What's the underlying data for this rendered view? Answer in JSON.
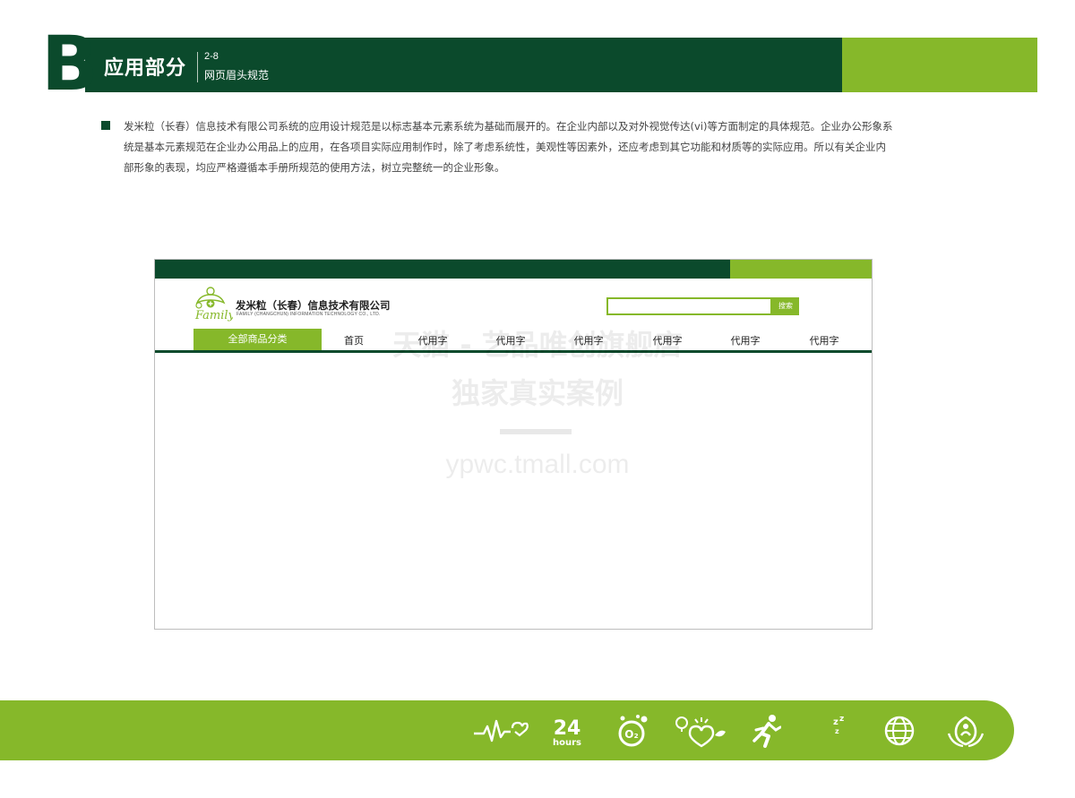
{
  "header": {
    "letter": "B",
    "section_title": "应用部分",
    "section_number": "2-8",
    "section_subtitle": "网页眉头规范"
  },
  "intro": {
    "text": "发米粒（长春）信息技术有限公司系统的应用设计规范是以标志基本元素系统为基础而展开的。在企业内部以及对外视觉传达(vi)等方面制定的具体规范。企业办公形象系统是基本元素规范在企业办公用品上的应用，在各项目实际应用制作时，除了考虑系统性，美观性等因素外，还应考虑到其它功能和材质等的实际应用。所以有关企业内部形象的表现，均应严格遵循本手册所规范的使用方法，树立完整统一的企业形象。"
  },
  "mockup": {
    "logo_text": "Family",
    "company_cn": "发米粒（长春）信息技术有限公司",
    "company_en": "FAMILY (CHANGCHUN) INFORMATION TECHNOLOGY CO., LTD.",
    "search_value": "",
    "search_button": "搜索",
    "nav": {
      "category": "全部商品分类",
      "items": [
        "首页",
        "代用字",
        "代用字",
        "代用字",
        "代用字",
        "代用字",
        "代用字"
      ]
    }
  },
  "watermark": {
    "line1": "天猫 - 艺品唯创旗舰店",
    "line2": "独家真实案例",
    "line3": "ypwc.tmall.com"
  },
  "footer": {
    "icons": [
      "heartbeat-icon",
      "24-hours-icon",
      "oxygen-icon",
      "health-heart-icon",
      "running-icon",
      "sleep-icon",
      "globe-icon",
      "care-hands-icon"
    ],
    "hours_number": "24",
    "hours_label": "hours"
  },
  "colors": {
    "dark_green": "#0b4a2c",
    "light_green": "#86b82a"
  }
}
